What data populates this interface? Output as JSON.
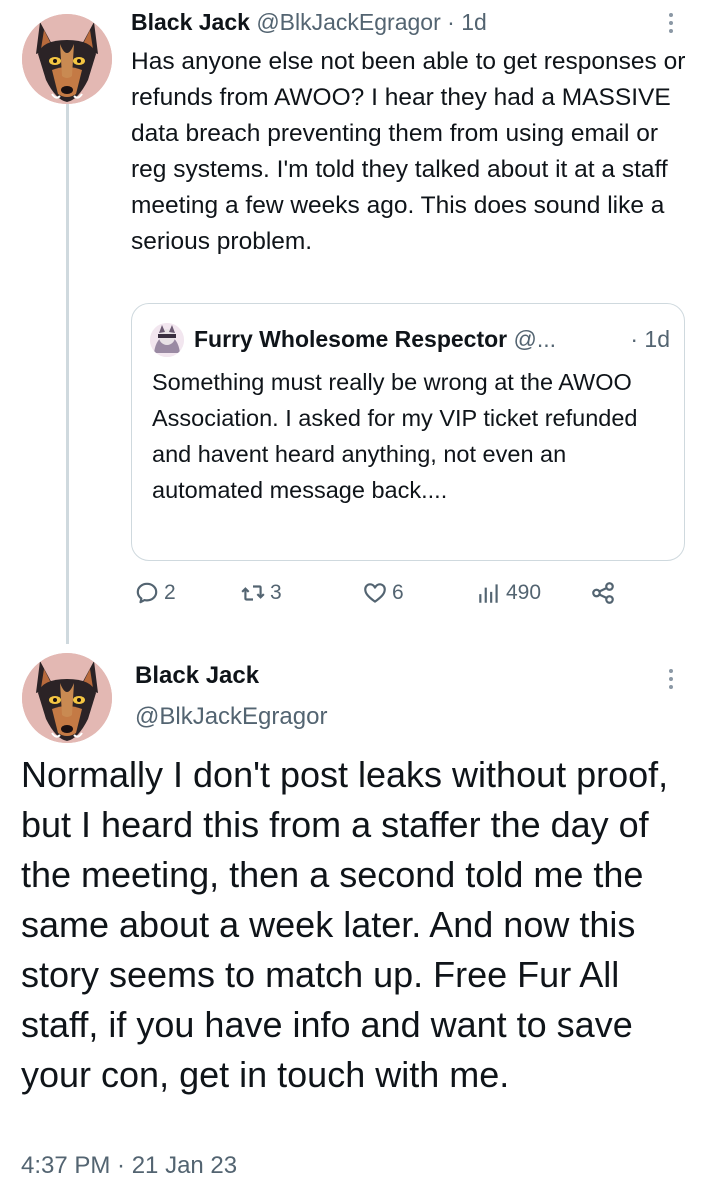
{
  "tweet1": {
    "author_name": "Black Jack",
    "author_handle": "@BlkJackEgragor",
    "separator": " · ",
    "time": "1d",
    "text": "Has anyone else not been able to get responses or refunds from AWOO? I hear they had a MASSIVE data breach preventing them from using email or reg systems. I'm told they talked about it at a staff meeting a few weeks ago. This does sound like a serious problem.",
    "quote": {
      "author_name": "Furry Wholesome Respector",
      "author_handle": "@...",
      "time": "· 1d",
      "text": "Something must really be wrong at the AWOO Association. I asked for my VIP ticket refunded and havent heard anything, not even an automated message back...."
    },
    "actions": {
      "replies": "2",
      "retweets": "3",
      "likes": "6",
      "views": "490"
    },
    "icons": [
      "more-icon",
      "reply-icon",
      "retweet-icon",
      "like-icon",
      "views-icon",
      "share-icon"
    ]
  },
  "tweet2": {
    "author_name": "Black Jack",
    "author_handle": "@BlkJackEgragor",
    "text": "Normally I don't post leaks without proof, but I heard this from a staffer the day of the meeting, then a second told me the same about a week later. And now this story seems to match up. Free Fur All staff, if you have info and want to save your con, get in touch with me.",
    "timestamp": "4:37 PM · 21 Jan 23"
  },
  "colors": {
    "text": "#0f1419",
    "secondary": "#536471",
    "border": "#cfd9de"
  }
}
